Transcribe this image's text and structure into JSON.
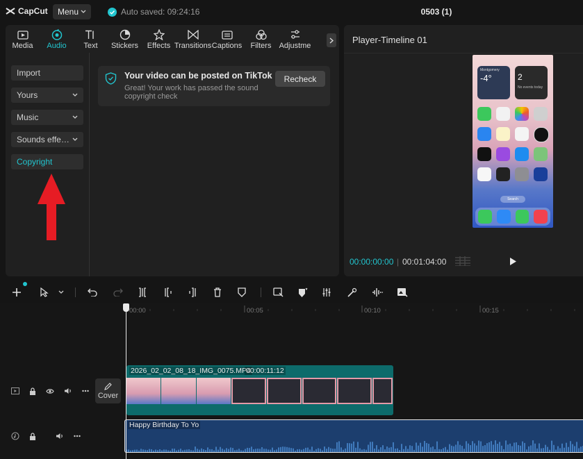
{
  "app": {
    "logo": "CapCut",
    "menu_label": "Menu",
    "autosave": "Auto saved: 09:24:16",
    "project_title": "0503 (1)"
  },
  "tabs": [
    {
      "label": "Media",
      "icon": "media-icon",
      "active": false
    },
    {
      "label": "Audio",
      "icon": "audio-icon",
      "active": true
    },
    {
      "label": "Text",
      "icon": "text-icon",
      "active": false
    },
    {
      "label": "Stickers",
      "icon": "sticker-icon",
      "active": false
    },
    {
      "label": "Effects",
      "icon": "effects-icon",
      "active": false
    },
    {
      "label": "Transitions",
      "icon": "transitions-icon",
      "active": false
    },
    {
      "label": "Captions",
      "icon": "captions-icon",
      "active": false
    },
    {
      "label": "Filters",
      "icon": "filters-icon",
      "active": false
    },
    {
      "label": "Adjustme",
      "icon": "adjustment-icon",
      "active": false
    }
  ],
  "sidebar": {
    "items": [
      {
        "label": "Import",
        "dropdown": false
      },
      {
        "label": "Yours",
        "dropdown": true
      },
      {
        "label": "Music",
        "dropdown": true
      },
      {
        "label": "Sounds effe…",
        "dropdown": true
      },
      {
        "label": "Copyright",
        "dropdown": false,
        "active": true
      }
    ]
  },
  "notice": {
    "title": "Your video can be posted on TikTok",
    "description": "Great! Your work has passed the sound copyright check",
    "button": "Recheck"
  },
  "player": {
    "title": "Player-Timeline 01",
    "current_time": "00:00:00:00",
    "total_time": "00:01:04:00",
    "phone": {
      "widget_weather": "-4°",
      "widget_weather_city": "Montgomery",
      "widget_calendar_day": "2",
      "widget_calendar_text": "No events today",
      "search_label": "Search"
    }
  },
  "timeline": {
    "ruler_labels": [
      "00:00",
      "00:05",
      "00:10",
      "00:15"
    ],
    "cover_label": "Cover",
    "video_clip": {
      "name": "2026_02_02_08_18_IMG_0075.MP4",
      "duration": "00:00:11:12"
    },
    "audio_clip": {
      "name": "Happy Birthday To Yo"
    }
  },
  "colors": {
    "accent": "#22c5cf",
    "video_clip": "#0d6b6b",
    "audio_clip": "#1c3e6e",
    "annotation_arrow": "#e61c24"
  }
}
